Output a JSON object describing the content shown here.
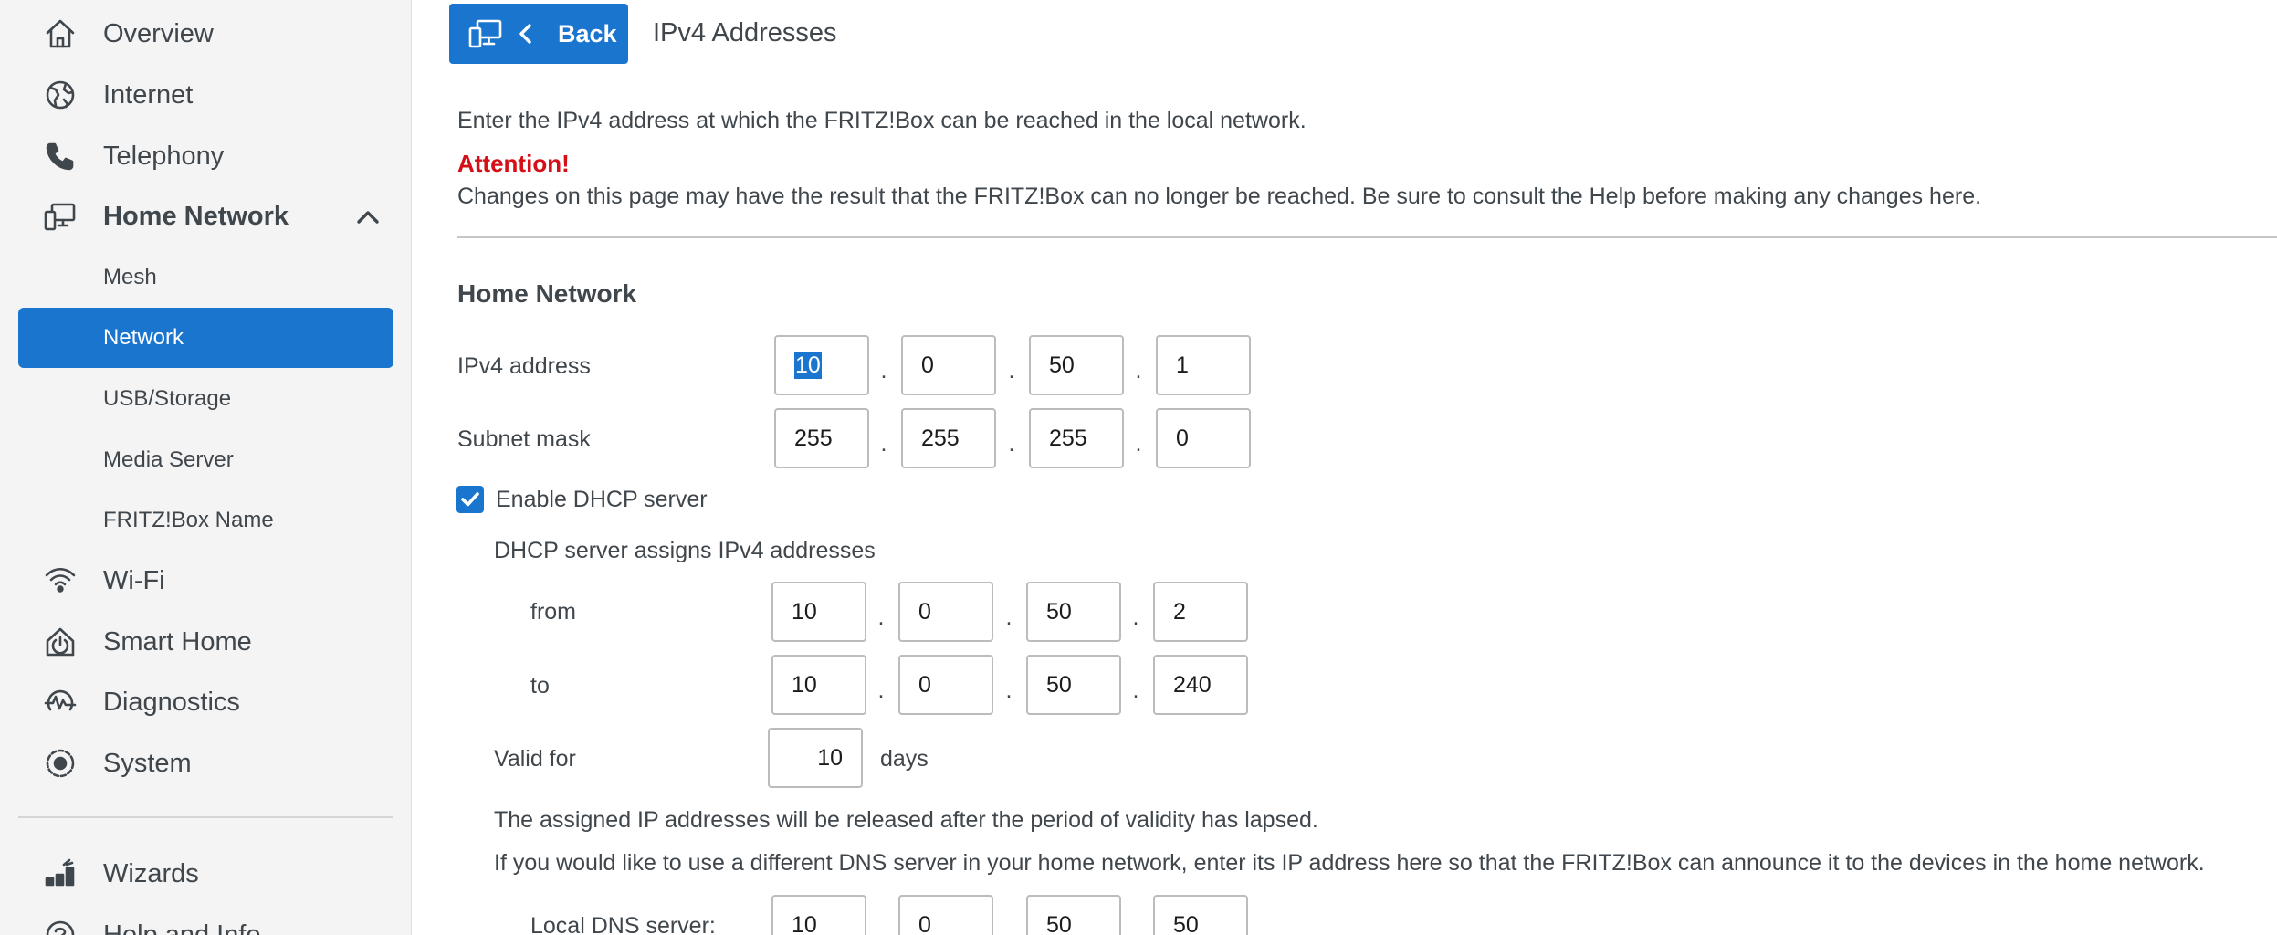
{
  "sidebar": {
    "items": [
      {
        "label": "Overview",
        "icon": "home-icon"
      },
      {
        "label": "Internet",
        "icon": "globe-icon"
      },
      {
        "label": "Telephony",
        "icon": "phone-icon"
      },
      {
        "label": "Home Network",
        "icon": "home-network-icon",
        "expanded": true
      },
      {
        "label": "Wi-Fi",
        "icon": "wifi-icon"
      },
      {
        "label": "Smart Home",
        "icon": "smart-home-icon"
      },
      {
        "label": "Diagnostics",
        "icon": "diagnostics-icon"
      },
      {
        "label": "System",
        "icon": "system-icon"
      },
      {
        "label": "Wizards",
        "icon": "wizards-icon"
      },
      {
        "label": "Help and Info",
        "icon": "help-icon"
      }
    ],
    "subitems": [
      {
        "label": "Mesh",
        "active": false
      },
      {
        "label": "Network",
        "active": true
      },
      {
        "label": "USB/Storage",
        "active": false
      },
      {
        "label": "Media Server",
        "active": false
      },
      {
        "label": "FRITZ!Box Name",
        "active": false
      }
    ]
  },
  "header": {
    "back_label": "Back",
    "title": "IPv4 Addresses"
  },
  "content": {
    "intro": "Enter the IPv4 address at which the FRITZ!Box can be reached in the local network.",
    "attention": "Attention!",
    "warning": "Changes on this page may have the result that the FRITZ!Box can no longer be reached. Be sure to consult the Help before making any changes here.",
    "section_title": "Home Network",
    "ipv4": {
      "label": "IPv4 address",
      "octets": [
        "10",
        "0",
        "50",
        "1"
      ]
    },
    "subnet": {
      "label": "Subnet mask",
      "octets": [
        "255",
        "255",
        "255",
        "0"
      ]
    },
    "dhcp_enable": {
      "label": "Enable DHCP server",
      "checked": true
    },
    "dhcp_heading": "DHCP server assigns IPv4 addresses",
    "from": {
      "label": "from",
      "octets": [
        "10",
        "0",
        "50",
        "2"
      ]
    },
    "to": {
      "label": "to",
      "octets": [
        "10",
        "0",
        "50",
        "240"
      ]
    },
    "valid": {
      "label": "Valid for",
      "value": "10",
      "unit": "days"
    },
    "release_note": "The assigned IP addresses will be released after the period of validity has lapsed.",
    "dns_note": "If you would like to use a different DNS server in your home network, enter its IP address here so that the FRITZ!Box can announce it to the devices in the home network.",
    "dns": {
      "label": "Local DNS server:",
      "octets": [
        "10",
        "0",
        "50",
        "50"
      ]
    },
    "dot": "."
  },
  "colors": {
    "accent": "#1a75cf",
    "attention": "#d50f17",
    "sidebar_bg": "#f4f4f4",
    "text": "#3f464c"
  }
}
